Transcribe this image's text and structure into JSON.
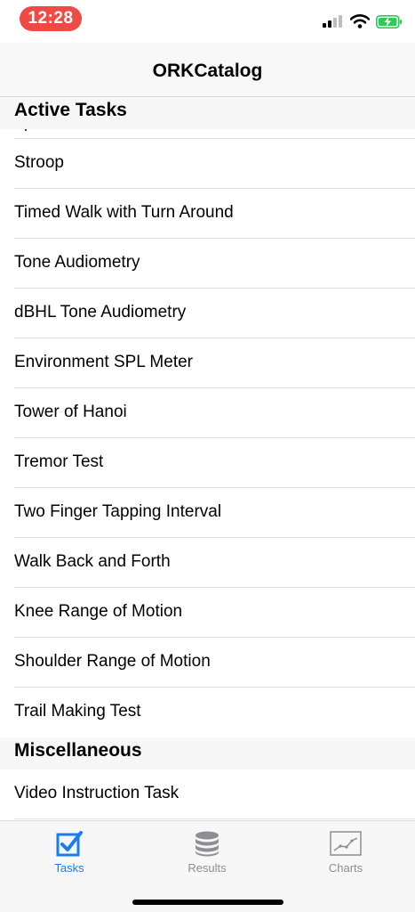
{
  "status_bar": {
    "time": "12:28",
    "icons": [
      "cellular-signal-icon",
      "wifi-icon",
      "battery-charging-icon"
    ],
    "time_pill_color": "#f04a45",
    "battery_color": "#34c759"
  },
  "nav": {
    "title": "ORKCatalog"
  },
  "sections": [
    {
      "header": "Active Tasks",
      "items": [
        "Stroop",
        "Timed Walk with Turn Around",
        "Tone Audiometry",
        "dBHL Tone Audiometry",
        "Environment SPL Meter",
        "Tower of Hanoi",
        "Tremor Test",
        "Two Finger Tapping Interval",
        "Walk Back and Forth",
        "Knee Range of Motion",
        "Shoulder Range of Motion",
        "Trail Making Test"
      ]
    },
    {
      "header": "Miscellaneous",
      "items": [
        "Video Instruction Task"
      ]
    }
  ],
  "tab_bar": {
    "tabs": [
      {
        "label": "Tasks",
        "icon": "checkbox-icon",
        "active": true
      },
      {
        "label": "Results",
        "icon": "database-icon",
        "active": false
      },
      {
        "label": "Charts",
        "icon": "line-chart-icon",
        "active": false
      }
    ],
    "active_color": "#1a7cf2",
    "inactive_color": "#8e8e93"
  }
}
